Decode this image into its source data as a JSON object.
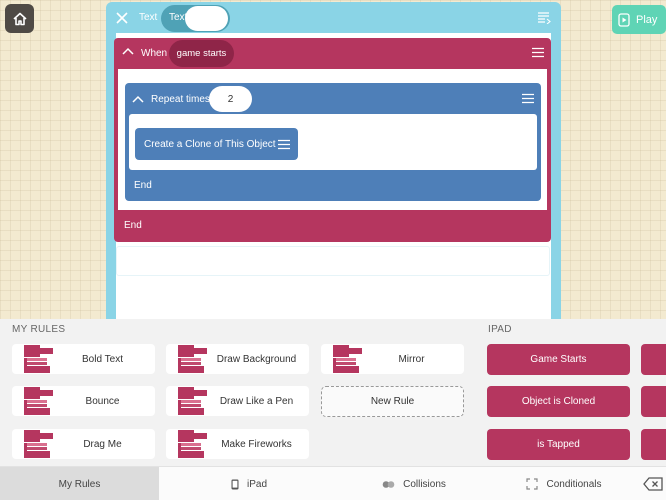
{
  "colors": {
    "editor_header": "#8ad4e6",
    "event_block": "#b5365f",
    "repeat_block": "#4e7fb8",
    "play_button": "#5fd4b5",
    "home_button": "#4f4a45"
  },
  "top": {
    "play_label": "Play"
  },
  "editor": {
    "object_label": "Text",
    "object_name": "Text"
  },
  "when_block": {
    "label": "When",
    "event": "game starts",
    "end": "End"
  },
  "repeat_block": {
    "label": "Repeat times",
    "value": "2",
    "end": "End"
  },
  "clone_block": {
    "label": "Create a Clone of This Object"
  },
  "my_rules": {
    "heading": "MY RULES",
    "items": [
      "Bold Text",
      "Draw Background",
      "Mirror",
      "Bounce",
      "Draw Like a Pen",
      "Drag Me",
      "Make Fireworks"
    ],
    "new_rule": "New Rule"
  },
  "ipad_rules": {
    "heading": "IPAD",
    "items": [
      "Game Starts",
      "Object is Cloned",
      "is Tapped"
    ]
  },
  "tabs": [
    {
      "label": "My Rules",
      "icon": "rules-icon"
    },
    {
      "label": "iPad",
      "icon": "ipad-icon"
    },
    {
      "label": "Collisions",
      "icon": "collisions-icon"
    },
    {
      "label": "Conditionals",
      "icon": "conditionals-icon"
    }
  ]
}
